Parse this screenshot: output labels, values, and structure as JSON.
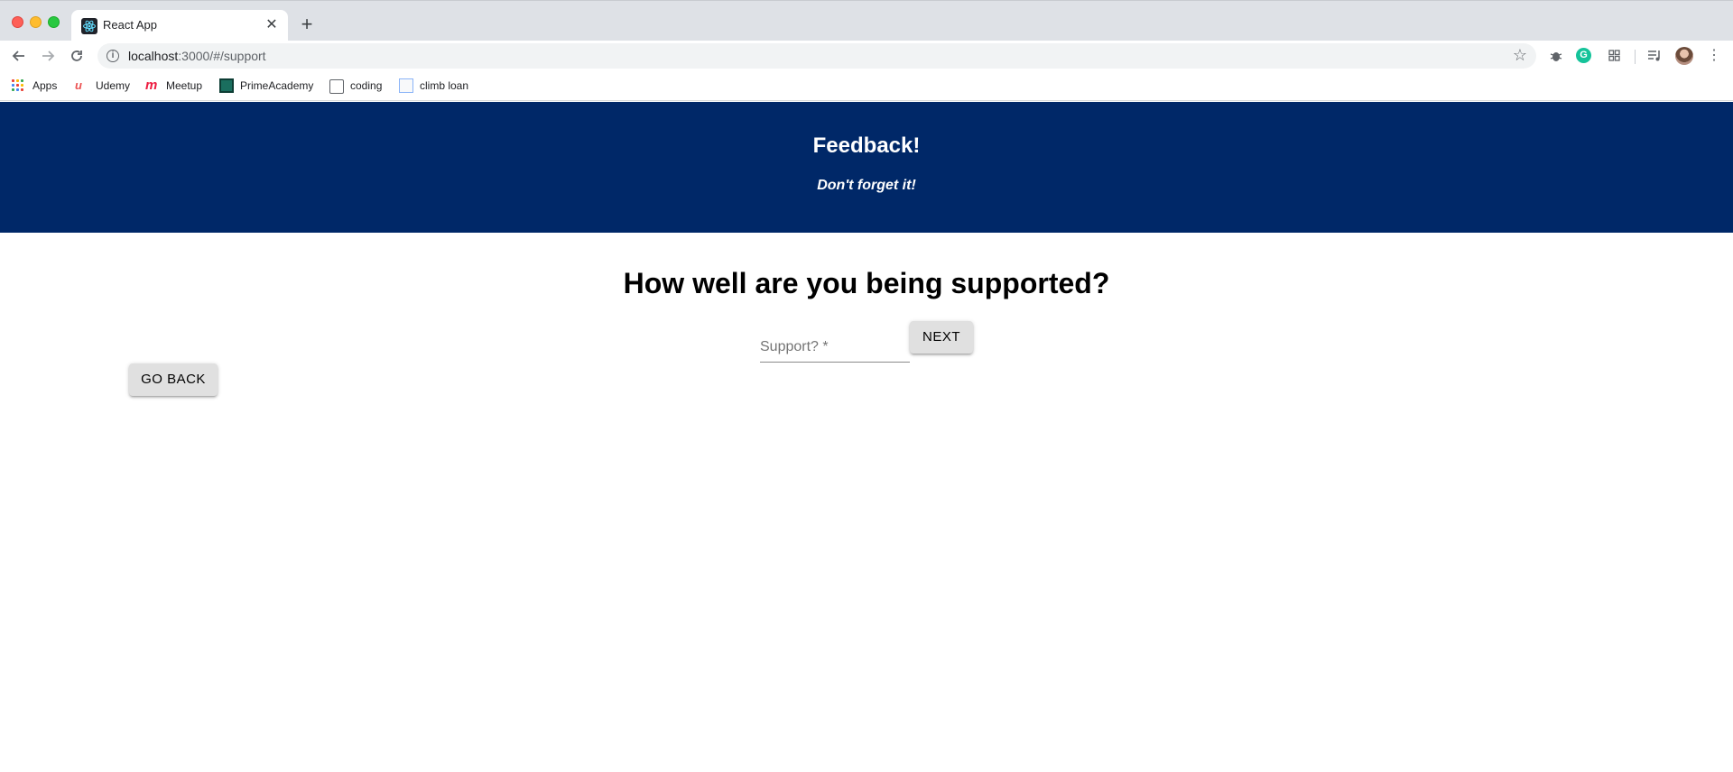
{
  "browser": {
    "tab": {
      "title": "React App",
      "close": "✕"
    },
    "new_tab": "+",
    "url": {
      "host": "localhost",
      "path": ":3000/#/support"
    },
    "icons": {
      "back": "arrow-left-icon",
      "forward": "arrow-right-icon",
      "reload": "reload-icon",
      "info": "info-icon",
      "star": "star-icon",
      "menu": "kebab-menu-icon"
    },
    "bookmarks": [
      {
        "label": "Apps"
      },
      {
        "label": "Udemy"
      },
      {
        "label": "Meetup"
      },
      {
        "label": "PrimeAcademy"
      },
      {
        "label": "coding"
      },
      {
        "label": "climb loan"
      }
    ]
  },
  "header": {
    "title": "Feedback!",
    "subtitle": "Don't forget it!",
    "background_color": "#002868"
  },
  "main": {
    "question": "How well are you being supported?",
    "support_field": {
      "label": "Support? *",
      "value": ""
    },
    "next_label": "NEXT",
    "back_label": "GO BACK"
  }
}
